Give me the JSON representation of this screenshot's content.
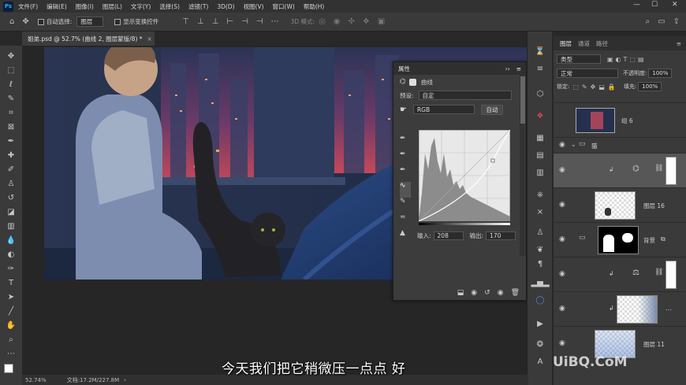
{
  "menubar": {
    "logo": "Ps",
    "items": [
      "文件(F)",
      "编辑(E)",
      "图像(I)",
      "图层(L)",
      "文字(Y)",
      "选择(S)",
      "滤镜(T)",
      "3D(D)",
      "视图(V)",
      "窗口(W)",
      "帮助(H)"
    ],
    "window_controls": [
      "—",
      "☐",
      "✕"
    ]
  },
  "options": {
    "auto_select_label": "自动选择:",
    "auto_select_value": "图层",
    "show_transform_label": "显示变换控件",
    "mode_3d_label": "3D 模式:"
  },
  "document": {
    "tab_title": "姐弟.psd @ 52.7% (曲线 2, 图层蒙版/8) *",
    "tab_close": "×"
  },
  "status": {
    "zoom": "52.74%",
    "doc_info": "文档:17.2M/227.8M",
    "arrow": "›"
  },
  "properties": {
    "panel_title": "属性",
    "panel_menu": "≡",
    "panel_collapse": "››",
    "adjustment_name": "曲线",
    "preset_label": "预设:",
    "preset_value": "自定",
    "channel_value": "RGB",
    "auto_button": "自动",
    "input_label": "输入:",
    "input_value": "208",
    "output_label": "输出:",
    "output_value": "170"
  },
  "layers": {
    "tabs": [
      "图层",
      "通道",
      "路径"
    ],
    "kind_filter": "类型",
    "blend_mode": "正常",
    "opacity_label": "不透明度:",
    "opacity_value": "100%",
    "lock_label": "锁定:",
    "fill_label": "填充:",
    "fill_value": "100%",
    "rows": [
      {
        "name": "组 6"
      },
      {
        "name": "猫"
      },
      {
        "name": ""
      },
      {
        "name": "图层 16"
      },
      {
        "name": "背景"
      },
      {
        "name": ""
      },
      {
        "name": ""
      },
      {
        "name": "图层 11"
      }
    ]
  },
  "subtitle": "今天我们把它稍微压一点点 好",
  "watermark": "UiBQ.CoM"
}
